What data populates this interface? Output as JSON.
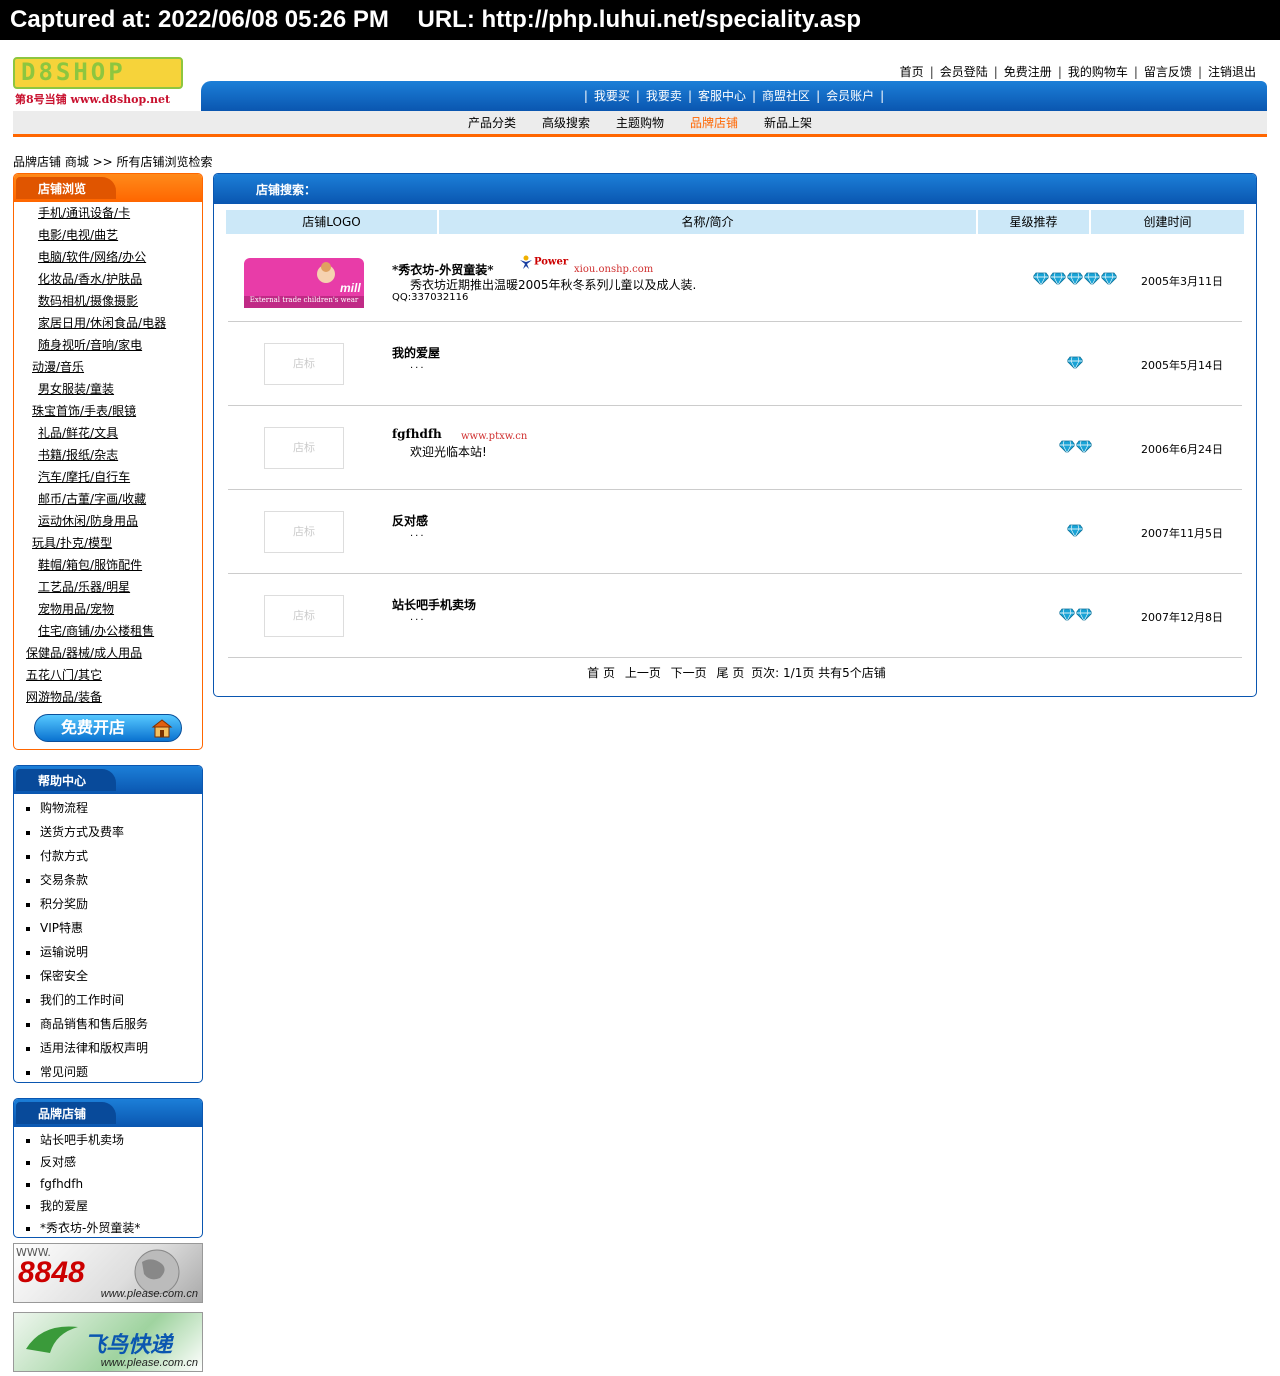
{
  "capture": {
    "time": "Captured at: 2022/06/08 05:26 PM",
    "url": "URL: http://php.luhui.net/speciality.asp"
  },
  "logo": {
    "mark": "D8SHOP",
    "subtitle": "第8号当铺 www.d8shop.net"
  },
  "top_links": [
    "首页",
    "会员登陆",
    "免费注册",
    "我的购物车",
    "留言反馈",
    "注销退出"
  ],
  "blue_nav": [
    "我要买",
    "我要卖",
    "客服中心",
    "商盟社区",
    "会员账户"
  ],
  "grey_nav": [
    "产品分类",
    "高级搜索",
    "主题购物",
    "品牌店铺",
    "新品上架"
  ],
  "breadcrumb": "品牌店铺 商城 >> 所有店铺浏览检索",
  "category_panel": {
    "title": "店铺浏览",
    "items": [
      {
        "label": "手机/通讯设备/卡",
        "indent": 2
      },
      {
        "label": "电影/电视/曲艺",
        "indent": 2
      },
      {
        "label": "电脑/软件/网络/办公",
        "indent": 2
      },
      {
        "label": "化妆品/香水/护肤品",
        "indent": 2
      },
      {
        "label": "数码相机/摄像摄影",
        "indent": 2
      },
      {
        "label": "家居日用/休闲食品/电器",
        "indent": 2
      },
      {
        "label": "随身视听/音响/家电",
        "indent": 2
      },
      {
        "label": "动漫/音乐",
        "indent": 1
      },
      {
        "label": "男女服装/童装",
        "indent": 2
      },
      {
        "label": "珠宝首饰/手表/眼镜",
        "indent": 1
      },
      {
        "label": "礼品/鲜花/文具",
        "indent": 2
      },
      {
        "label": "书籍/报纸/杂志",
        "indent": 2
      },
      {
        "label": "汽车/摩托/自行车",
        "indent": 2
      },
      {
        "label": "邮币/古董/字画/收藏",
        "indent": 2
      },
      {
        "label": "运动休闲/防身用品",
        "indent": 2
      },
      {
        "label": "玩具/扑克/模型",
        "indent": 1
      },
      {
        "label": "鞋帽/箱包/服饰配件",
        "indent": 2
      },
      {
        "label": "工艺品/乐器/明星",
        "indent": 2
      },
      {
        "label": "宠物用品/宠物",
        "indent": 2
      },
      {
        "label": "住宅/商铺/办公楼租售",
        "indent": 2
      },
      {
        "label": "保健品/器械/成人用品",
        "indent": 0
      },
      {
        "label": "五花八门/其它",
        "indent": 0
      },
      {
        "label": "网游物品/装备",
        "indent": 0
      }
    ],
    "free_shop_button": "免费开店"
  },
  "help_panel": {
    "title": "帮助中心",
    "items": [
      "购物流程",
      "送货方式及费率",
      "付款方式",
      "交易条款",
      "积分奖励",
      "VIP特惠",
      "运输说明",
      "保密安全",
      "我们的工作时间",
      "商品销售和售后服务",
      "适用法律和版权声明",
      "常见问题"
    ]
  },
  "brand_panel": {
    "title": "品牌店铺",
    "items": [
      "站长吧手机卖场",
      "反对感",
      "fgfhdfh",
      "我的爱屋",
      "*秀衣坊-外贸童装*"
    ]
  },
  "banners": [
    {
      "www": "WWW.",
      "big": "8848",
      "url": "www.please.com.cn"
    },
    {
      "www": "",
      "big": "飞鸟快递",
      "url": "www.please.com.cn"
    }
  ],
  "main": {
    "title": "店铺搜索：",
    "columns": [
      "店铺LOGO",
      "名称/简介",
      "星级推荐",
      "创建时间"
    ],
    "placeholder_logo": "店标",
    "power_label": "Power",
    "rows": [
      {
        "name": "*秀衣坊-外贸童装*",
        "site": "xiou.onshp.com",
        "desc": "秀衣坊近期推出温暖2005年秋冬系列儿童以及成人装.",
        "qq": "QQ:337032116",
        "logo_caption": "External trade children's wear",
        "stars": 5,
        "date": "2005年3月11日"
      },
      {
        "name": "我的爱屋",
        "site": "",
        "desc": "",
        "qq": "",
        "stars": 1,
        "date": "2005年5月14日"
      },
      {
        "name": "fgfhdfh",
        "site": "www.ptxw.cn",
        "desc": "欢迎光临本站!",
        "qq": "",
        "stars": 2,
        "date": "2006年6月24日"
      },
      {
        "name": "反对感",
        "site": "",
        "desc": "",
        "qq": "",
        "stars": 1,
        "date": "2007年11月5日"
      },
      {
        "name": "站长吧手机卖场",
        "site": "",
        "desc": "",
        "qq": "",
        "stars": 2,
        "date": "2007年12月8日"
      }
    ],
    "ellipsis": "...",
    "pager": {
      "first": "首 页",
      "prev": "上一页",
      "next": "下一页",
      "last": "尾 页",
      "pages": "页次: 1/1页",
      "total": "共有5个店铺"
    }
  },
  "colors": {
    "orange": "#ff6600",
    "blue": "#0a56b0",
    "header_light": "#cce8f8",
    "gem": "#19a3d6"
  }
}
